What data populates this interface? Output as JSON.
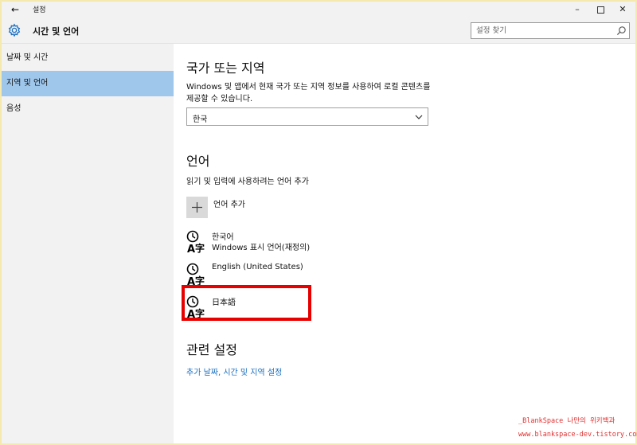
{
  "titlebar": {
    "back": "←",
    "title": "설정",
    "minimize": "–",
    "close": "✕"
  },
  "header": {
    "app_title": "시간 및 언어",
    "search_placeholder": "설정 찾기"
  },
  "sidebar": {
    "items": [
      {
        "label": "날짜 및 시간",
        "active": false
      },
      {
        "label": "지역 및 언어",
        "active": true
      },
      {
        "label": "음성",
        "active": false
      }
    ]
  },
  "region": {
    "heading": "국가 또는 지역",
    "description": "Windows 및 앱에서 현재 국가 또는 지역 정보를 사용하여 로컬 콘텐츠를 제공할 수 있습니다.",
    "selected": "한국"
  },
  "language": {
    "heading": "언어",
    "description": "읽기 및 입력에 사용하려는 언어 추가",
    "add_label": "언어 추가",
    "items": [
      {
        "name": "한국어",
        "sub": "Windows 표시 언어(재정의)"
      },
      {
        "name": "English (United States)",
        "sub": ""
      },
      {
        "name": "日本語",
        "sub": ""
      }
    ]
  },
  "related": {
    "heading": "관련 설정",
    "link": "추가 날짜, 시간 및 지역 설정"
  },
  "watermark": {
    "line1": "_BlankSpace 나만의 위키백과",
    "line2": "www.blankspace-dev.tistory.com"
  },
  "colors": {
    "accent": "#9fc7ec",
    "link": "#1a6fc0",
    "highlight": "#e60000"
  }
}
